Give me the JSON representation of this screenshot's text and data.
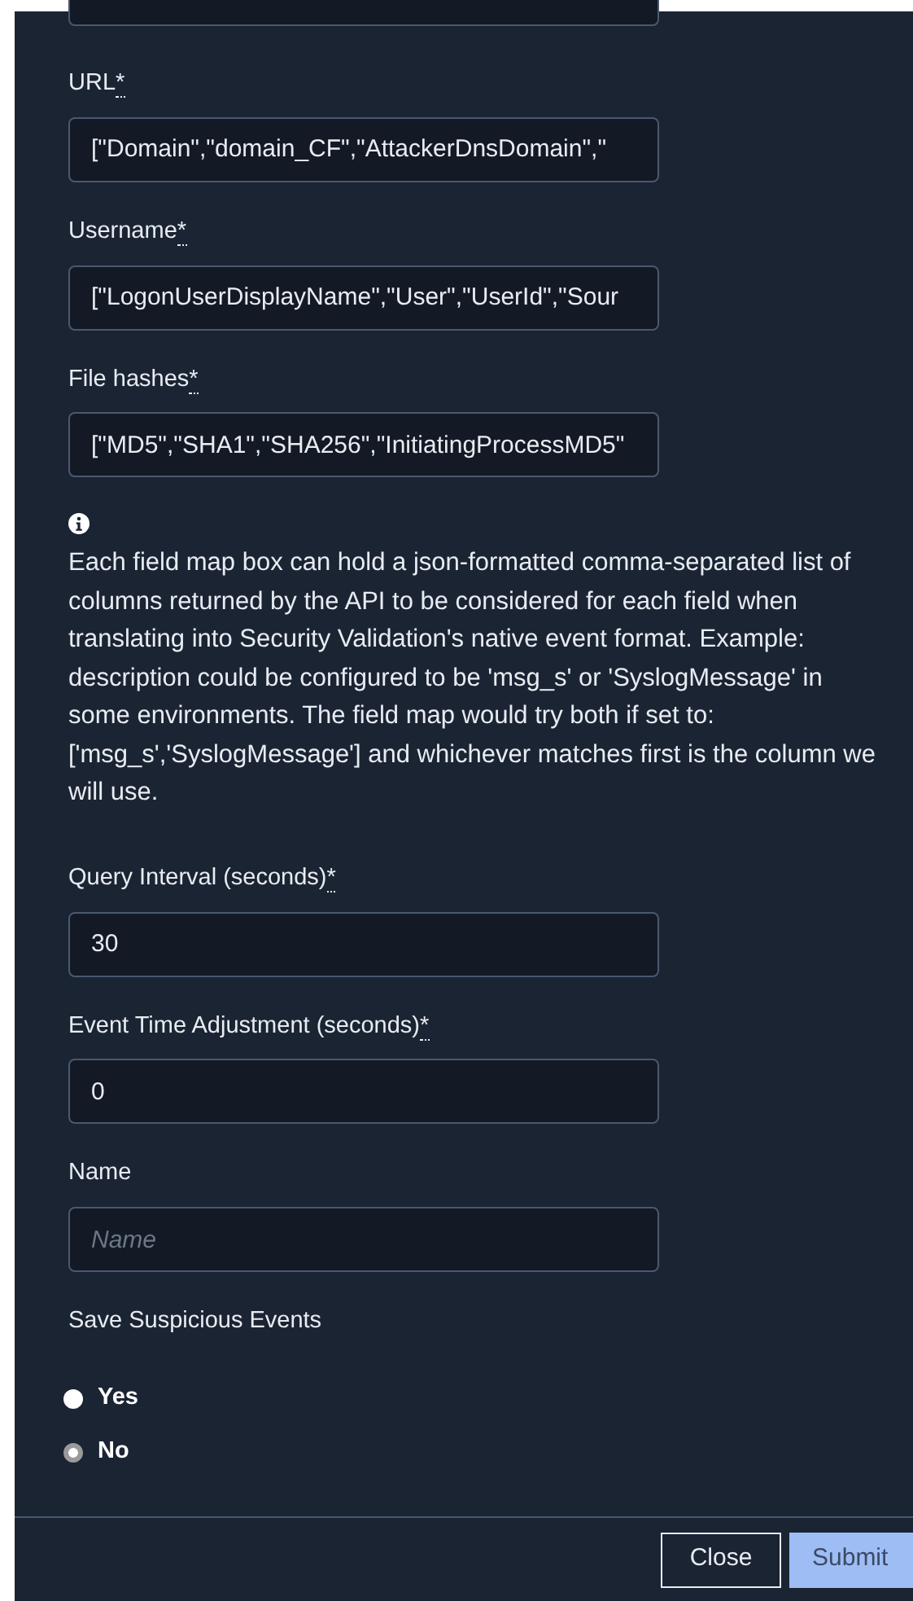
{
  "required_mark": "*",
  "fields": [
    {
      "kind": "cut"
    },
    {
      "kind": "text",
      "label": "URL",
      "required": true,
      "value": "[\"Domain\",\"domain_CF\",\"AttackerDnsDomain\",\""
    },
    {
      "kind": "text",
      "label": "Username",
      "required": true,
      "value": "[\"LogonUserDisplayName\",\"User\",\"UserId\",\"Sour"
    },
    {
      "kind": "text",
      "label": "File hashes",
      "required": true,
      "value": "[\"MD5\",\"SHA1\",\"SHA256\",\"InitiatingProcessMD5\""
    },
    {
      "kind": "info",
      "text": "Each field map box can hold a json-formatted comma-separated list of columns returned by the API to be considered for each field when translating into Security Validation's native event format. Example: description could be configured to be 'msg_s' or 'SyslogMessage' in some environments. The field map would try both if set to: ['msg_s','SyslogMessage'] and whichever matches first is the column we will use."
    },
    {
      "kind": "text",
      "label": "Query Interval (seconds)",
      "required": true,
      "value": "30"
    },
    {
      "kind": "text",
      "label": "Event Time Adjustment (seconds)",
      "required": true,
      "value": "0"
    },
    {
      "kind": "text",
      "label": "Name",
      "required": false,
      "placeholder": "Name"
    },
    {
      "kind": "radio",
      "label": "Save Suspicious Events",
      "options": [
        {
          "label": "Yes",
          "selected": false
        },
        {
          "label": "No",
          "selected": true
        }
      ]
    }
  ],
  "buttons": [
    {
      "label": "Close",
      "kind": "secondary"
    },
    {
      "label": "Submit",
      "kind": "primary"
    }
  ]
}
